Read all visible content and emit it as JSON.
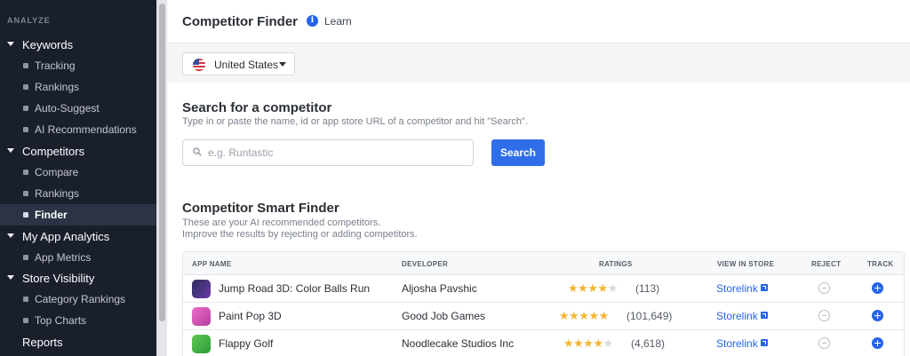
{
  "sidebar": {
    "section_label": "ANALYZE",
    "keywords": {
      "label": "Keywords",
      "items": [
        "Tracking",
        "Rankings",
        "Auto-Suggest",
        "AI Recommendations"
      ]
    },
    "competitors": {
      "label": "Competitors",
      "items": [
        "Compare",
        "Rankings",
        "Finder"
      ],
      "active_item": "Finder"
    },
    "my_app_analytics": {
      "label": "My App Analytics",
      "items": [
        "App Metrics"
      ]
    },
    "store_visibility": {
      "label": "Store Visibility",
      "items": [
        "Category Rankings",
        "Top Charts"
      ]
    },
    "reports": {
      "label": "Reports"
    }
  },
  "header": {
    "title": "Competitor Finder",
    "learn_label": "Learn",
    "info_glyph": "i"
  },
  "country": {
    "selected": "United States",
    "flag_icon": "us-flag-icon"
  },
  "search": {
    "title": "Search for a competitor",
    "subtitle": "Type in or paste the name, id or app store URL of a competitor and hit \"Search\".",
    "placeholder": "e.g. Runtastic",
    "button_label": "Search"
  },
  "smart_finder": {
    "title": "Competitor Smart Finder",
    "subtitle_line1": "These are your AI recommended competitors.",
    "subtitle_line2": "Improve the results by rejecting or adding competitors.",
    "columns": {
      "app_name": "APP NAME",
      "developer": "DEVELOPER",
      "ratings": "RATINGS",
      "view_in_store": "VIEW IN STORE",
      "reject": "REJECT",
      "track": "TRACK"
    },
    "rows": [
      {
        "app_name": "Jump Road 3D: Color Balls Run",
        "developer": "Aljosha Pavshic",
        "stars_glyphs": "★★★★",
        "stars_off_glyphs": "★",
        "rating_value": 4.0,
        "rating_count": "(113)",
        "storelink": "Storelink",
        "icon_color": "#2a2d5c"
      },
      {
        "app_name": "Paint Pop 3D",
        "developer": "Good Job Games",
        "stars_glyphs": "★★★★★",
        "stars_off_glyphs": "",
        "rating_value": 4.7,
        "rating_count": "(101,649)",
        "storelink": "Storelink",
        "icon_color": "#d94fb7"
      },
      {
        "app_name": "Flappy Golf",
        "developer": "Noodlecake Studios Inc",
        "stars_glyphs": "★★★★",
        "stars_off_glyphs": "★",
        "rating_value": 4.5,
        "rating_count": "(4,618)",
        "storelink": "Storelink",
        "icon_color": "#4db848"
      }
    ]
  },
  "colors": {
    "sidebar_bg": "#1a1f2c",
    "accent_blue": "#2f6ee8",
    "star_gold": "#f2b632"
  }
}
